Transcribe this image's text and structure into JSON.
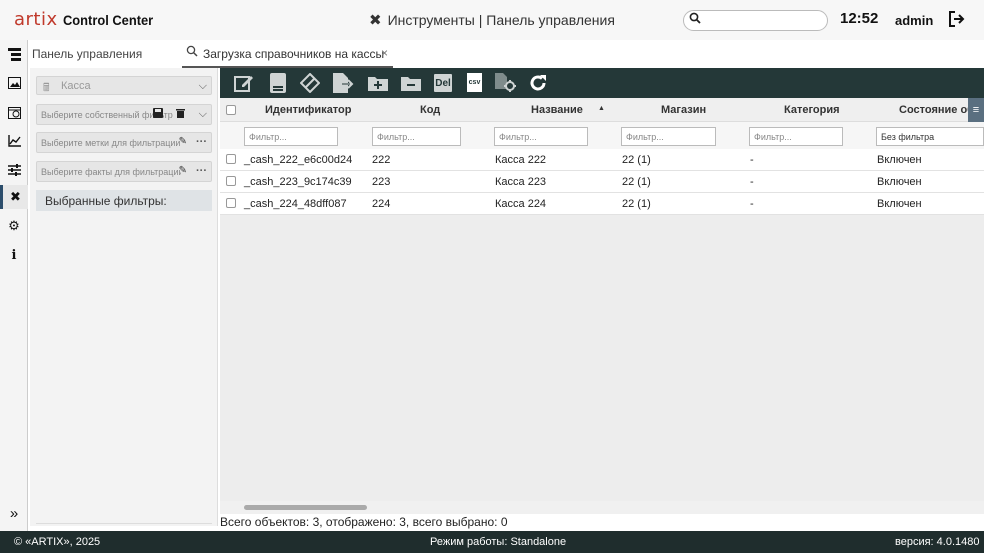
{
  "header": {
    "logo_text": "artix",
    "app_name": "Control Center",
    "page_title": "Инструменты | Панель управления",
    "search_value": "",
    "clock": "12:52",
    "user": "admin"
  },
  "tabs": [
    {
      "label": "Панель управления",
      "active": false
    },
    {
      "label": "Загрузка справочников на кассы",
      "active": true,
      "close": "×"
    }
  ],
  "filters": {
    "cash_select": "Касса",
    "own_filter_placeholder": "Выберите собственный фильтр",
    "labels_placeholder": "Выберите метки для фильтрации",
    "facts_placeholder": "Выберите факты для фильтрации",
    "chosen_label": "Выбранные фильтры:",
    "more": "···"
  },
  "toolbar": {
    "del_label": "Del",
    "csv_label": "csv"
  },
  "grid": {
    "columns": [
      "Идентификатор",
      "Код",
      "Название",
      "Магазин",
      "Категория",
      "Состояние об"
    ],
    "sort_indicator": "▲",
    "filter_placeholder": "Фильтр...",
    "state_filter_value": "Без фильтра",
    "rows": [
      {
        "id": "_cash_222_e6c00d24",
        "code": "222",
        "name": "Касса 222",
        "shop": "22 (1)",
        "category": "-",
        "state": "Включен"
      },
      {
        "id": "_cash_223_9c174c39",
        "code": "223",
        "name": "Касса 223",
        "shop": "22 (1)",
        "category": "-",
        "state": "Включен"
      },
      {
        "id": "_cash_224_48dff087",
        "code": "224",
        "name": "Касса 224",
        "shop": "22 (1)",
        "category": "-",
        "state": "Включен"
      }
    ]
  },
  "status": "Всего объектов: 3, отображено: 3, всего выбрано: 0",
  "footer": {
    "copyright": "© «ARTIX», 2025",
    "mode": "Режим работы: Standalone",
    "version": "версия: 4.0.1480"
  },
  "iconbar": {
    "expand": "»"
  },
  "colors": {
    "toolbar_bg": "#243838",
    "footer_bg": "#1f2d2d",
    "logo_red": "#c0392b"
  }
}
